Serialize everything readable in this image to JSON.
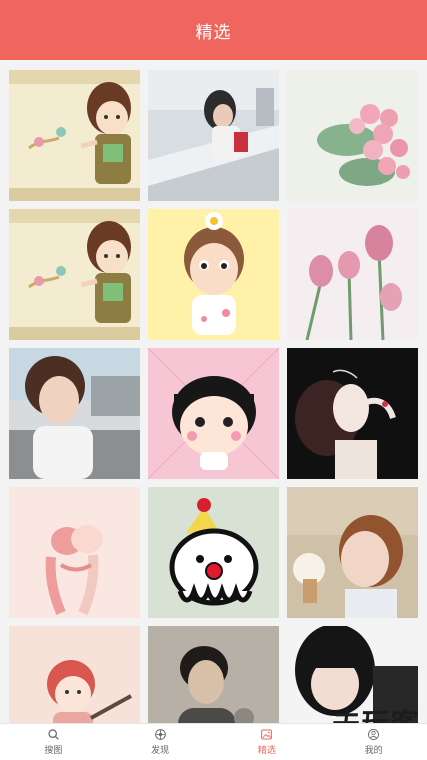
{
  "header": {
    "title": "精选"
  },
  "tabs": [
    {
      "label": "搜图",
      "icon": "search-icon",
      "active": false
    },
    {
      "label": "发现",
      "icon": "compass-icon",
      "active": false
    },
    {
      "label": "精选",
      "icon": "image-icon",
      "active": true
    },
    {
      "label": "我的",
      "icon": "user-icon",
      "active": false
    }
  ],
  "watermark": "夫玩客",
  "colors": {
    "accent": "#f0665e",
    "tab_text": "#666666",
    "background": "#f2f2f2"
  },
  "images": [
    "cartoon-girl-balloons",
    "girl-leaning-railing",
    "pink-roses-bouquet",
    "cartoon-girl-balloons",
    "cartoon-girl-daisy",
    "pink-tulips",
    "short-hair-girl-street",
    "chibi-maruko-cartoon",
    "woman-dark-background",
    "cartoon-couple-hugging",
    "clown-ghost-cartoon",
    "girl-eating-ice-cream",
    "cartoon-girl-red-hair",
    "young-man-portrait",
    "girl-bangs-portrait"
  ]
}
